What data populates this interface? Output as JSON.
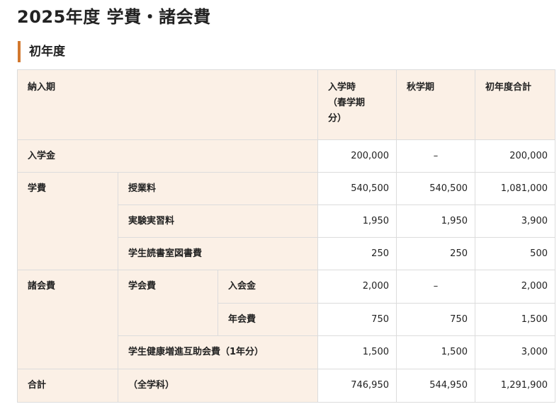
{
  "page": {
    "title": "2025年度 学費・諸会費"
  },
  "section": {
    "title": "初年度"
  },
  "table": {
    "headers": {
      "period": "納入期",
      "entry": "入学時",
      "entry_note_1": "（春学期",
      "entry_note_2": "分）",
      "autumn": "秋学期",
      "total": "初年度合計"
    },
    "rows": {
      "admission": {
        "label": "入学金",
        "entry": "200,000",
        "autumn": "–",
        "total": "200,000"
      },
      "tuition_group": "学費",
      "tuition": {
        "label": "授業料",
        "entry": "540,500",
        "autumn": "540,500",
        "total": "1,081,000"
      },
      "lab": {
        "label": "実験実習料",
        "entry": "1,950",
        "autumn": "1,950",
        "total": "3,900"
      },
      "reading": {
        "label": "学生読書室図書費",
        "entry": "250",
        "autumn": "250",
        "total": "500"
      },
      "fees_group": "諸会費",
      "society_group": "学会費",
      "join_fee": {
        "label": "入会金",
        "entry": "2,000",
        "autumn": "–",
        "total": "2,000"
      },
      "annual_fee": {
        "label": "年会費",
        "entry": "750",
        "autumn": "750",
        "total": "1,500"
      },
      "health": {
        "label": "学生健康増進互助会費（1年分）",
        "entry": "1,500",
        "autumn": "1,500",
        "total": "3,000"
      },
      "sum": {
        "label": "合計",
        "note": "（全学科）",
        "entry": "746,950",
        "autumn": "544,950",
        "total": "1,291,900"
      }
    }
  }
}
